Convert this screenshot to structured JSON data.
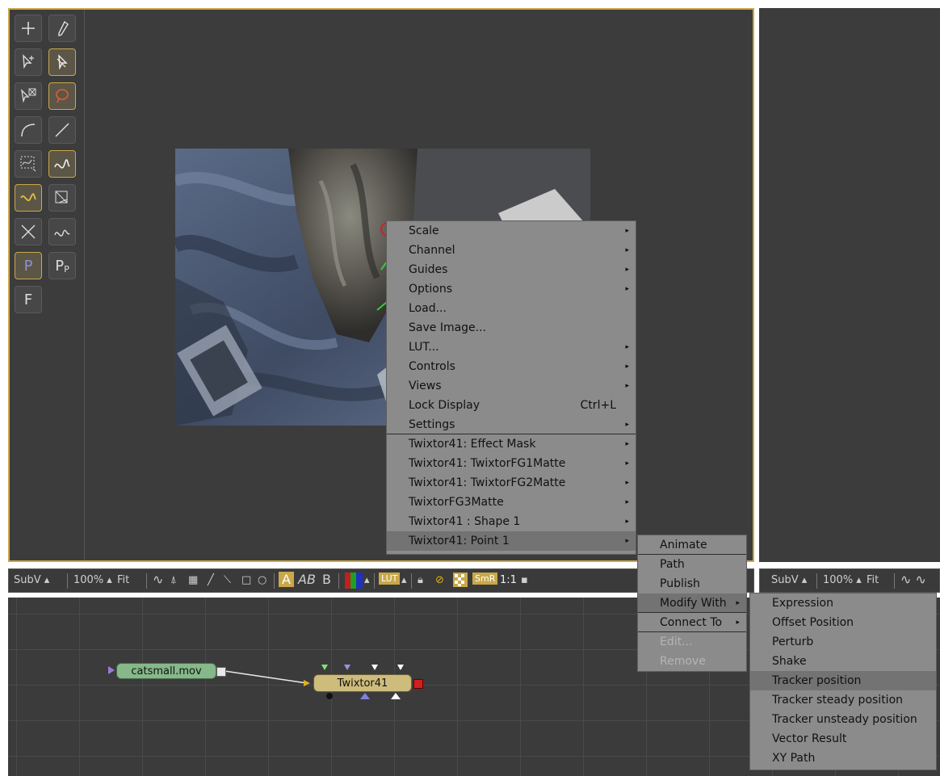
{
  "viewer": {
    "tools_left": [
      "+",
      "✎",
      "R⊞",
      "◊",
      "F"
    ],
    "tool_letters": {
      "p_active": "P",
      "pp_main": "P",
      "pp_sub": "P",
      "f": "F"
    }
  },
  "toolbar": {
    "subv": "SubV",
    "zoom": "100%",
    "fit": "Fit",
    "a": "A",
    "ab": "AB",
    "b": "B",
    "lut": "LUT",
    "smr": "SmR",
    "ratio": "1:1"
  },
  "toolbar2": {
    "subv": "SubV",
    "zoom": "100%",
    "fit": "Fit"
  },
  "flow": {
    "loader": "catsmall.mov",
    "effect": "Twixtor41"
  },
  "context_menu": {
    "items": [
      {
        "label": "Scale",
        "arrow": "▸"
      },
      {
        "label": "Channel",
        "arrow": "▸"
      },
      {
        "label": "Guides",
        "arrow": "▸"
      },
      {
        "label": "Options",
        "arrow": "▸"
      },
      {
        "label": "Load...",
        "arrow": ""
      },
      {
        "label": "Save Image...",
        "arrow": ""
      },
      {
        "label": "LUT...",
        "arrow": "▸"
      },
      {
        "label": "Controls",
        "arrow": "▸"
      },
      {
        "label": "Views",
        "arrow": "▸"
      },
      {
        "label": "Lock Display",
        "arrow": "",
        "shortcut": "Ctrl+L"
      },
      {
        "label": "Settings",
        "arrow": "▸"
      },
      {
        "label": "Twixtor41: Effect Mask",
        "arrow": "▸"
      },
      {
        "label": "Twixtor41: TwixtorFG1Matte",
        "arrow": "▸"
      },
      {
        "label": "Twixtor41: TwixtorFG2Matte",
        "arrow": "▸"
      },
      {
        "label": "TwixtorFG3Matte",
        "arrow": "▸"
      },
      {
        "label": "Twixtor41 : Shape 1",
        "arrow": "▸"
      },
      {
        "label": "Twixtor41: Point 1",
        "arrow": "▸"
      }
    ]
  },
  "submenu1": {
    "items": [
      {
        "label": "Animate",
        "arrow": ""
      },
      {
        "label": "Path",
        "arrow": ""
      },
      {
        "label": "Publish",
        "arrow": ""
      },
      {
        "label": "Modify With",
        "arrow": "▸"
      },
      {
        "label": "Connect To",
        "arrow": "▸"
      },
      {
        "label": "Edit...",
        "arrow": ""
      },
      {
        "label": "Remove",
        "arrow": ""
      }
    ]
  },
  "submenu2": {
    "items": [
      {
        "label": "Expression"
      },
      {
        "label": "Offset Position"
      },
      {
        "label": "Perturb"
      },
      {
        "label": "Shake"
      },
      {
        "label": "Tracker position"
      },
      {
        "label": "Tracker steady position"
      },
      {
        "label": "Tracker unsteady position"
      },
      {
        "label": "Vector Result"
      },
      {
        "label": "XY Path"
      }
    ]
  }
}
